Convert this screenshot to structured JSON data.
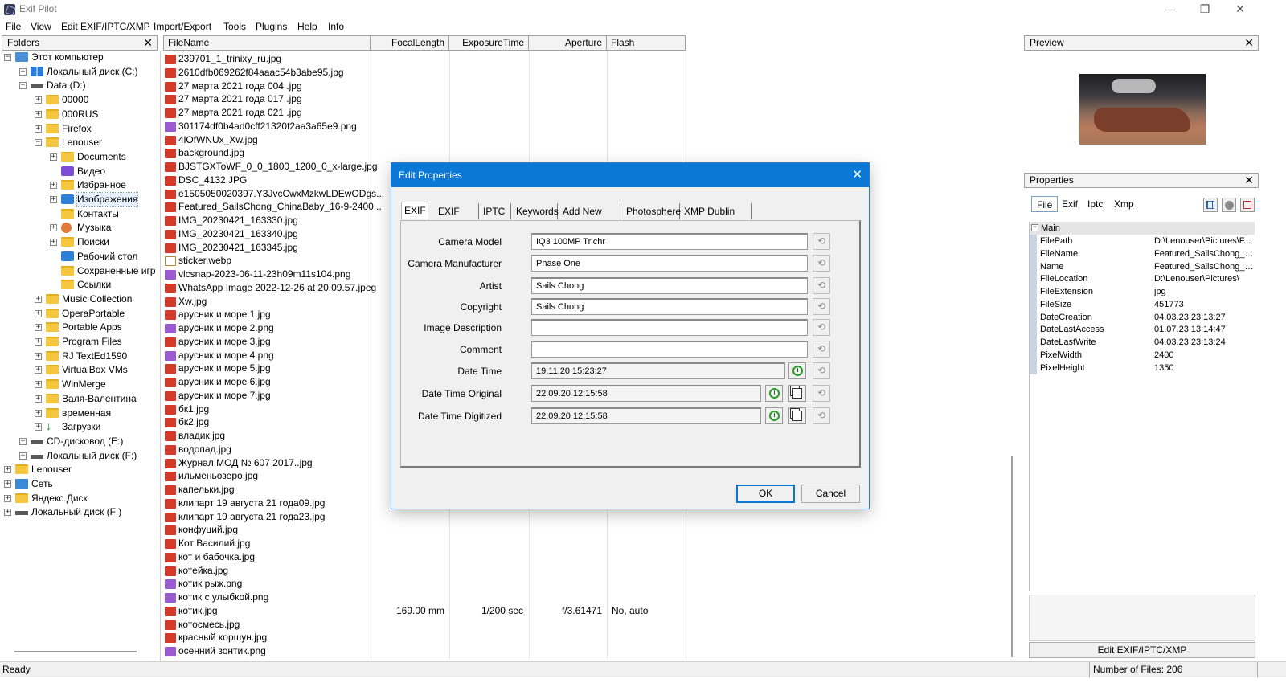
{
  "window": {
    "title": "Exif Pilot",
    "minimize": "—",
    "maximize": "❐",
    "close": "✕"
  },
  "menu": [
    "File",
    "View",
    "Edit EXIF/IPTC/XMP",
    "Import/Export",
    "Tools",
    "Plugins",
    "Help",
    "Info"
  ],
  "folders": {
    "title": "Folders",
    "close": "✕",
    "tree": [
      {
        "label": "Этот компьютер",
        "icon": "computer-icon",
        "depth": 0,
        "expander": "−"
      },
      {
        "label": "Локальный диск (C:)",
        "icon": "windows-drive-icon",
        "depth": 1,
        "expander": "+"
      },
      {
        "label": "Data (D:)",
        "icon": "drive-icon",
        "depth": 1,
        "expander": "−"
      },
      {
        "label": "00000",
        "icon": "folder-icon",
        "depth": 2,
        "expander": "+"
      },
      {
        "label": "000RUS",
        "icon": "folder-icon",
        "depth": 2,
        "expander": "+"
      },
      {
        "label": "Firefox",
        "icon": "folder-icon",
        "depth": 2,
        "expander": "+"
      },
      {
        "label": "Lenouser",
        "icon": "folder-icon",
        "depth": 2,
        "expander": "−"
      },
      {
        "label": "Documents",
        "icon": "folder-icon",
        "depth": 3,
        "expander": "+"
      },
      {
        "label": "Видео",
        "icon": "video-icon",
        "depth": 3,
        "expander": ""
      },
      {
        "label": "Избранное",
        "icon": "folder-icon",
        "depth": 3,
        "expander": "+"
      },
      {
        "label": "Изображения",
        "icon": "image-folder-icon",
        "depth": 3,
        "expander": "+",
        "selected": true
      },
      {
        "label": "Контакты",
        "icon": "folder-icon",
        "depth": 3,
        "expander": ""
      },
      {
        "label": "Музыка",
        "icon": "music-icon",
        "depth": 3,
        "expander": "+"
      },
      {
        "label": "Поиски",
        "icon": "folder-icon",
        "depth": 3,
        "expander": "+"
      },
      {
        "label": "Рабочий стол",
        "icon": "desktop-icon",
        "depth": 3,
        "expander": ""
      },
      {
        "label": "Сохраненные игр",
        "icon": "folder-icon",
        "depth": 3,
        "expander": ""
      },
      {
        "label": "Ссылки",
        "icon": "folder-icon",
        "depth": 3,
        "expander": ""
      },
      {
        "label": "Music Collection",
        "icon": "folder-icon",
        "depth": 2,
        "expander": "+"
      },
      {
        "label": "OperaPortable",
        "icon": "folder-icon",
        "depth": 2,
        "expander": "+"
      },
      {
        "label": "Portable Apps",
        "icon": "folder-icon",
        "depth": 2,
        "expander": "+"
      },
      {
        "label": "Program Files",
        "icon": "folder-icon",
        "depth": 2,
        "expander": "+"
      },
      {
        "label": "RJ TextEd1590",
        "icon": "folder-icon",
        "depth": 2,
        "expander": "+"
      },
      {
        "label": "VirtualBox VMs",
        "icon": "folder-icon",
        "depth": 2,
        "expander": "+"
      },
      {
        "label": "WinMerge",
        "icon": "folder-icon",
        "depth": 2,
        "expander": "+"
      },
      {
        "label": "Валя-Валентина",
        "icon": "folder-icon",
        "depth": 2,
        "expander": "+"
      },
      {
        "label": "временная",
        "icon": "folder-icon",
        "depth": 2,
        "expander": "+"
      },
      {
        "label": "Загрузки",
        "icon": "download-icon",
        "depth": 2,
        "expander": "+"
      },
      {
        "label": "CD-дисковод (E:)",
        "icon": "drive-icon",
        "depth": 1,
        "expander": "+"
      },
      {
        "label": "Локальный диск (F:)",
        "icon": "drive-icon",
        "depth": 1,
        "expander": "+"
      },
      {
        "label": "Lenouser",
        "icon": "folder-icon",
        "depth": 0,
        "expander": "+"
      },
      {
        "label": "Сеть",
        "icon": "network-icon",
        "depth": 0,
        "expander": "+"
      },
      {
        "label": "Яндекс.Диск",
        "icon": "folder-icon",
        "depth": 0,
        "expander": "+"
      },
      {
        "label": "Локальный диск (F:)",
        "icon": "drive-icon",
        "depth": 0,
        "expander": "+"
      }
    ]
  },
  "filelist": {
    "columns": [
      "FileName",
      "FocalLength",
      "ExposureTime",
      "Aperture",
      "Flash"
    ],
    "files": [
      {
        "type": "jpg",
        "name": "239701_1_trinixy_ru.jpg"
      },
      {
        "type": "jpg",
        "name": "2610dfb069262f84aaac54b3abe95.jpg"
      },
      {
        "type": "jpg",
        "name": "27 марта 2021 года 004 .jpg"
      },
      {
        "type": "jpg",
        "name": "27 марта 2021 года 017 .jpg"
      },
      {
        "type": "jpg",
        "name": "27 марта 2021 года 021 .jpg"
      },
      {
        "type": "png",
        "name": "301174df0b4ad0cff21320f2aa3a65e9.png"
      },
      {
        "type": "jpg",
        "name": "4lOfWNUx_Xw.jpg"
      },
      {
        "type": "jpg",
        "name": "background.jpg"
      },
      {
        "type": "jpg",
        "name": "BJSTGXToWF_0_0_1800_1200_0_x-large.jpg"
      },
      {
        "type": "jpg",
        "name": "DSC_4132.JPG"
      },
      {
        "type": "jpg",
        "name": "e1505050020397.Y3JvcCwxMzkwLDEwODgs..."
      },
      {
        "type": "jpg",
        "name": "Featured_SailsChong_ChinaBaby_16-9-2400..."
      },
      {
        "type": "jpg",
        "name": "IMG_20230421_163330.jpg"
      },
      {
        "type": "jpg",
        "name": "IMG_20230421_163340.jpg"
      },
      {
        "type": "jpg",
        "name": "IMG_20230421_163345.jpg"
      },
      {
        "type": "webp",
        "name": "sticker.webp"
      },
      {
        "type": "png",
        "name": "vlcsnap-2023-06-11-23h09m11s104.png"
      },
      {
        "type": "jpg",
        "name": "WhatsApp Image 2022-12-26 at 20.09.57.jpeg"
      },
      {
        "type": "jpg",
        "name": "Xw.jpg"
      },
      {
        "type": "jpg",
        "name": "арусник и море 1.jpg"
      },
      {
        "type": "png",
        "name": "арусник и море 2.png"
      },
      {
        "type": "jpg",
        "name": "арусник и море 3.jpg"
      },
      {
        "type": "png",
        "name": "арусник и море 4.png"
      },
      {
        "type": "jpg",
        "name": "арусник и море 5.jpg"
      },
      {
        "type": "jpg",
        "name": "арусник и море 6.jpg"
      },
      {
        "type": "jpg",
        "name": "арусник и море 7.jpg"
      },
      {
        "type": "jpg",
        "name": "бк1.jpg"
      },
      {
        "type": "jpg",
        "name": "бк2.jpg"
      },
      {
        "type": "jpg",
        "name": "владик.jpg"
      },
      {
        "type": "jpg",
        "name": "водопад.jpg"
      },
      {
        "type": "jpg",
        "name": "Журнал МОД № 607 2017..jpg"
      },
      {
        "type": "jpg",
        "name": "ильменьозеро.jpg"
      },
      {
        "type": "jpg",
        "name": "капельки.jpg"
      },
      {
        "type": "jpg",
        "name": "клипарт 19 августа 21 года09.jpg"
      },
      {
        "type": "jpg",
        "name": "клипарт 19 августа 21 года23.jpg"
      },
      {
        "type": "jpg",
        "name": "конфуций.jpg"
      },
      {
        "type": "jpg",
        "name": "Кот Василий.jpg"
      },
      {
        "type": "jpg",
        "name": "кот и бабочка.jpg"
      },
      {
        "type": "jpg",
        "name": "котейка.jpg"
      },
      {
        "type": "png",
        "name": "котик рыж.png"
      },
      {
        "type": "png",
        "name": "котик с улыбкой.png"
      },
      {
        "type": "jpg",
        "name": "котик.jpg",
        "focal": "169.00 mm",
        "exposure": "1/200 sec",
        "aperture": "f/3.61471",
        "flash": "No, auto"
      },
      {
        "type": "jpg",
        "name": "котосмесь.jpg"
      },
      {
        "type": "jpg",
        "name": "красный коршун.jpg"
      },
      {
        "type": "png",
        "name": "осенний зонтик.png"
      }
    ]
  },
  "preview": {
    "title": "Preview",
    "close": "✕"
  },
  "properties": {
    "title": "Properties",
    "close": "✕",
    "tabs": [
      "File",
      "Exif",
      "Iptc",
      "Xmp"
    ],
    "active_tab": "File",
    "group": "Main",
    "group_expander": "−",
    "rows": [
      {
        "key": "FilePath",
        "value": "D:\\Lenouser\\Pictures\\F..."
      },
      {
        "key": "FileName",
        "value": "Featured_SailsChong_C..."
      },
      {
        "key": "Name",
        "value": "Featured_SailsChong_C..."
      },
      {
        "key": "FileLocation",
        "value": "D:\\Lenouser\\Pictures\\"
      },
      {
        "key": "FileExtension",
        "value": "jpg"
      },
      {
        "key": "FileSize",
        "value": "451773"
      },
      {
        "key": "DateCreation",
        "value": "04.03.23 23:13:27"
      },
      {
        "key": "DateLastAccess",
        "value": "01.07.23 13:14:47"
      },
      {
        "key": "DateLastWrite",
        "value": "04.03.23 23:13:24"
      },
      {
        "key": "PixelWidth",
        "value": "2400"
      },
      {
        "key": "PixelHeight",
        "value": "1350"
      }
    ],
    "edit_button": "Edit EXIF/IPTC/XMP"
  },
  "status": {
    "ready": "Ready",
    "count": "Number of Files: 206"
  },
  "dialog": {
    "title": "Edit Properties",
    "close": "✕",
    "tabs": [
      "EXIF",
      "EXIF GPS",
      "IPTC",
      "Keywords",
      "Add New Tags",
      "Photosphere",
      "XMP Dublin Core"
    ],
    "active_tab": "EXIF",
    "fields": [
      {
        "label": "Camera Model",
        "value": "IQ3 100MP Trichr",
        "kind": "text"
      },
      {
        "label": "Camera Manufacturer",
        "value": "Phase One",
        "kind": "text"
      },
      {
        "label": "Artist",
        "value": "Sails Chong",
        "kind": "text"
      },
      {
        "label": "Copyright",
        "value": "Sails Chong",
        "kind": "text"
      },
      {
        "label": "Image Description",
        "value": "",
        "kind": "text"
      },
      {
        "label": "Comment",
        "value": "",
        "kind": "text"
      },
      {
        "label": "Date Time",
        "value": "19.11.20 15:23:27",
        "kind": "date"
      },
      {
        "label": "Date Time Original",
        "value": "22.09.20 12:15:58",
        "kind": "date-copy"
      },
      {
        "label": "Date Time Digitized",
        "value": "22.09.20 12:15:58",
        "kind": "date-copy"
      }
    ],
    "revert_glyph": "⟲",
    "ok": "OK",
    "cancel": "Cancel"
  }
}
